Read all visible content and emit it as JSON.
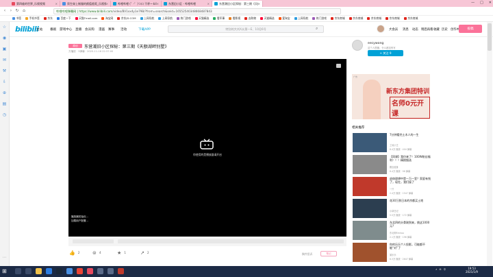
{
  "tabs": [
    {
      "label": "第四维的世界_乐视视频",
      "color": "#e84a5f"
    },
    {
      "label": "男生穿上制服的颜值差距_乐视视频",
      "color": "#4a90e2"
    },
    {
      "label": "哔哩哔哩 (゜-゜)つロ 干杯~-bilibili",
      "color": "#00a1d6"
    },
    {
      "label": "东营旧小区 - 哔哩哔哩",
      "color": "#00a1d6"
    },
    {
      "label": "东营潮旧小区探秘：第三期《天额湖畔别墅》",
      "color": "#00a1d6"
    }
  ],
  "window_controls": [
    "—",
    "□",
    "✕"
  ],
  "address": {
    "secure_label": "哔哩哔哩弹幕网",
    "url_host": "https://www.bilibili.com",
    "url_path": "/video/BV1xx4y1e79B/?from=search&seid=16552540348668487843"
  },
  "bookmarks": [
    {
      "label": "书签",
      "color": "#4a90e2"
    },
    {
      "label": "手机书签",
      "color": "#f5a623"
    },
    {
      "label": "京东",
      "color": "#e1251b"
    },
    {
      "label": "百度一下",
      "color": "#2d7de0"
    },
    {
      "label": "天猫Tmall.com",
      "color": "#ff0036"
    },
    {
      "label": "淘宝网",
      "color": "#ff5000"
    },
    {
      "label": "京东JD.COM",
      "color": "#e1251b"
    },
    {
      "label": "上网导航",
      "color": "#2d9de0"
    },
    {
      "label": "上网导航",
      "color": "#2d9de0"
    },
    {
      "label": "热门游戏",
      "color": "#9b59b6"
    },
    {
      "label": "天猫精选",
      "color": "#ff0036"
    },
    {
      "label": "看军事",
      "color": "#27ae60"
    },
    {
      "label": "看影视",
      "color": "#e67e22"
    },
    {
      "label": "去购物",
      "color": "#e1251b"
    },
    {
      "label": "天猫精选",
      "color": "#ff0036"
    },
    {
      "label": "爱淘宝",
      "color": "#ff5000"
    },
    {
      "label": "上网导航",
      "color": "#2d9de0"
    },
    {
      "label": "热门游戏",
      "color": "#9b59b6"
    },
    {
      "label": "京东商城",
      "color": "#e1251b"
    },
    {
      "label": "京东商城",
      "color": "#e1251b"
    },
    {
      "label": "京东商城",
      "color": "#e1251b"
    },
    {
      "label": "京东商城",
      "color": "#e1251b"
    },
    {
      "label": "京东商城",
      "color": "#e1251b"
    }
  ],
  "nav": {
    "logo": "bilibili",
    "links": [
      "主站",
      "番剧",
      "游戏中心",
      "直播",
      "会员购",
      "漫画",
      "赛事",
      "活动",
      "下载APP"
    ],
    "search_placeholder": "特别的大刘X从第一E、10月6号",
    "right_links": [
      "大会员",
      "消息",
      "动态",
      "稍后再看",
      "收藏",
      "历史",
      "创作中心"
    ],
    "upload": "投稿"
  },
  "video": {
    "tag": "原创",
    "title": "东营潮旧小区探秘：第三期《天额湖畔别墅》",
    "meta": "万播放 · 5弹幕 · 2020-11-16 22:37:00",
    "player_message": "你使用的是播放器请开启",
    "subtitle_lines": [
      "播放器初始化...",
      "加载用户配置..."
    ],
    "actions": [
      {
        "icon": "👍",
        "name": "like",
        "count": "2"
      },
      {
        "icon": "⊜",
        "name": "coin",
        "count": "4"
      },
      {
        "icon": "★",
        "name": "favorite",
        "count": "1"
      },
      {
        "icon": "↗",
        "name": "share",
        "count": "2"
      }
    ],
    "report": "稿件投诉",
    "more": "笔记"
  },
  "uploader": {
    "name": "eecywong",
    "desc": "这个人很懒，什么都没有写",
    "follow": "+ 关注 9"
  },
  "ad": {
    "label": "广告",
    "headline1": "新东方集团特训",
    "headline2": "名师0元开课"
  },
  "related": {
    "title": "相关推荐",
    "items": [
      {
        "title": "7分钟看完土木人的一生",
        "up": "工地小王",
        "stat": "8.4万 播放 · 404 弹幕",
        "thumb": "#3b5a78"
      },
      {
        "title": "【同课】我仿来了！100W粉丝福利！！！精挑细选",
        "up": "刚嘉健身",
        "stat": "6.4万 播放 · 96 弹幕",
        "thumb": "#8a8a8a"
      },
      {
        "title": "退休理想中是一万一室？家庭有钱了，现在，我们接了",
        "up": "一只",
        "stat": "2.4万 播放 · 1547 弹幕",
        "thumb": "#c0392b"
      },
      {
        "title": "花30万到日本的京都买土地",
        "up": "小郭日记",
        "stat": "5.5万 播放 · 172 弹幕",
        "thumb": "#2c3e50"
      },
      {
        "title": "东北四的头骨刚到来，挑这1000元?",
        "up": "东北狗Rmhao",
        "stat": "2.1万 播放 · 196 弹幕",
        "thumb": "#7f8c8d"
      },
      {
        "title": "你的乐乐个人投影，可能都不能“对”了",
        "up": "某乐乐",
        "stat": "6.3万 播放 · 2647 弹幕",
        "thumb": "#a0522d"
      }
    ]
  },
  "taskbar": {
    "apps": [
      {
        "name": "search",
        "color": "#3a4a68"
      },
      {
        "name": "taskview",
        "color": "#3a4a68"
      },
      {
        "name": "explorer",
        "color": "#f0c14b"
      },
      {
        "name": "edge",
        "color": "#2d7de0"
      },
      {
        "name": "steam",
        "color": "#1b2838"
      },
      {
        "name": "browser",
        "color": "#4a90e2"
      },
      {
        "name": "chrome",
        "color": "#ea4335"
      },
      {
        "name": "media",
        "color": "#e84a5f"
      },
      {
        "name": "files",
        "color": "#5a6a88"
      },
      {
        "name": "app",
        "color": "#5a6a88"
      },
      {
        "name": "netease",
        "color": "#c0392b"
      }
    ],
    "tray": [
      "∧",
      "⊞",
      "中"
    ],
    "time": "19:53",
    "date": "2021/1/9"
  }
}
